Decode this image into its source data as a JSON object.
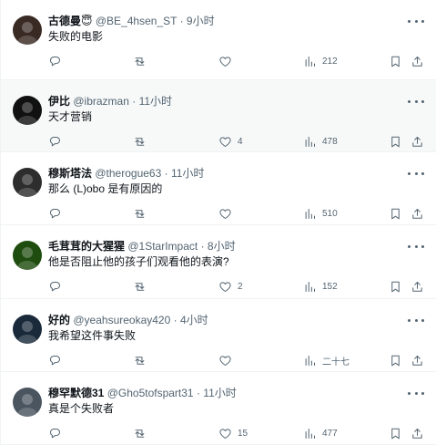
{
  "tweets": [
    {
      "display_name": "古德曼",
      "badge_emoji": "😇",
      "handle": "@BE_4hsen_ST",
      "separator": "·",
      "time": "9小时",
      "text": "失败的电影",
      "reply_count": "",
      "retweet_count": "",
      "like_count": "",
      "view_count": "212",
      "highlighted": false,
      "avatar_color": "#3a2a24"
    },
    {
      "display_name": "伊比",
      "handle": "@ibrazman",
      "separator": "·",
      "time": "11小时",
      "text": "天才营销",
      "reply_count": "",
      "retweet_count": "",
      "like_count": "4",
      "view_count": "478",
      "highlighted": true,
      "avatar_color": "#111111"
    },
    {
      "display_name": "穆斯塔法",
      "handle": "@therogue63",
      "separator": "·",
      "time": "11小时",
      "text": "那么 (L)obo 是有原因的",
      "reply_count": "",
      "retweet_count": "",
      "like_count": "",
      "view_count": "510",
      "highlighted": false,
      "avatar_color": "#2d2d2d"
    },
    {
      "display_name": "毛茸茸的大猩猩",
      "handle": "@1StarImpact",
      "separator": "·",
      "time": "8小时",
      "text": "他是否阻止他的孩子们观看他的表演?",
      "reply_count": "",
      "retweet_count": "",
      "like_count": "2",
      "view_count": "152",
      "highlighted": false,
      "avatar_color": "#1f4d10"
    },
    {
      "display_name": "好的",
      "handle": "@yeahsureokay420",
      "separator": "·",
      "time": "4小时",
      "text": "我希望这件事失败",
      "reply_count": "",
      "retweet_count": "",
      "like_count": "",
      "view_count": "二十七",
      "highlighted": false,
      "avatar_color": "#1a2a3a"
    },
    {
      "display_name": "穆罕默德31",
      "handle": "@Gho5tofspart31",
      "separator": "·",
      "time": "11小时",
      "text": "真是个失败者",
      "reply_count": "",
      "retweet_count": "",
      "like_count": "15",
      "view_count": "477",
      "highlighted": false,
      "avatar_color": "#4a5560"
    }
  ],
  "colors": {
    "text_primary": "#0f1419",
    "text_secondary": "#536471",
    "divider": "#eff3f4",
    "highlight_bg": "#f7f9f9"
  },
  "icons": {
    "reply": "speech-bubble-icon",
    "retweet": "retweet-icon",
    "like": "heart-icon",
    "views": "bar-chart-icon",
    "bookmark": "bookmark-icon",
    "share": "share-icon",
    "more": "more-dots-icon"
  }
}
